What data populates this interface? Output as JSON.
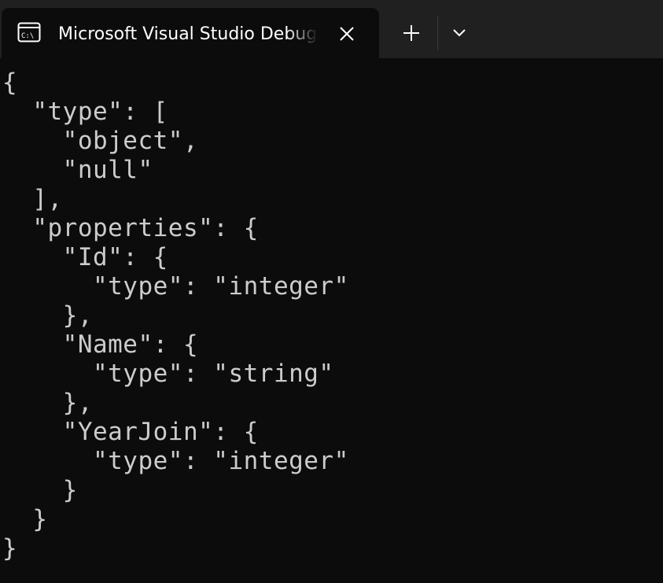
{
  "tab": {
    "title": "Microsoft Visual Studio Debug Console",
    "icon": "console-icon",
    "close_icon": "close-icon"
  },
  "toolbar": {
    "new_tab_icon": "plus-icon",
    "dropdown_icon": "chevron-down-icon"
  },
  "colors": {
    "background": "#0c0c0c",
    "titlebar": "#202020",
    "text": "#cccccc",
    "title_text": "#ffffff"
  },
  "console": {
    "lines": [
      "{",
      "  \"type\": [",
      "    \"object\",",
      "    \"null\"",
      "  ],",
      "  \"properties\": {",
      "    \"Id\": {",
      "      \"type\": \"integer\"",
      "    },",
      "    \"Name\": {",
      "      \"type\": \"string\"",
      "    },",
      "    \"YearJoin\": {",
      "      \"type\": \"integer\"",
      "    }",
      "  }",
      "}"
    ]
  }
}
